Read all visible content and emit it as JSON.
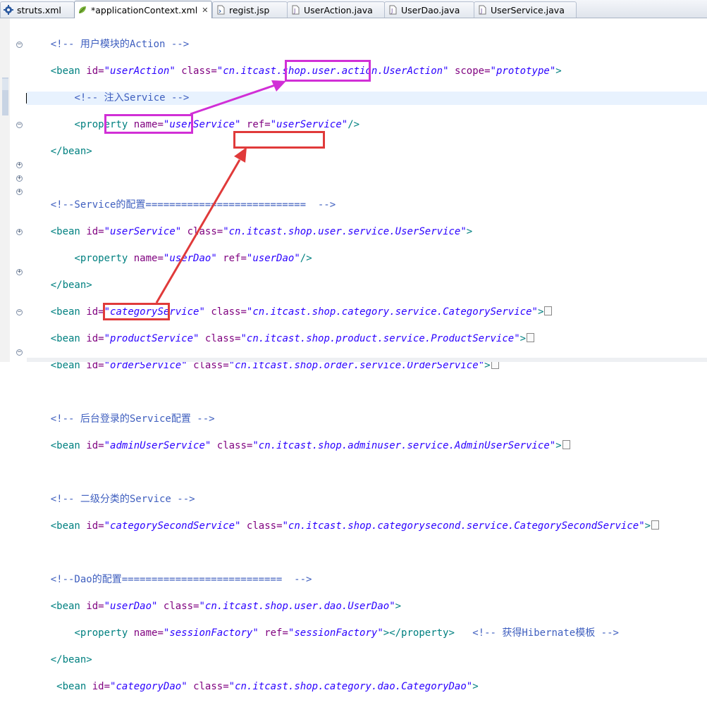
{
  "tabs": [
    {
      "label": "struts.xml",
      "icon": "gear-xml-icon",
      "active": false
    },
    {
      "label": "*applicationContext.xml",
      "icon": "spring-leaf-icon",
      "active": true,
      "close": "✕"
    },
    {
      "label": "regist.jsp",
      "icon": "jsp-file-icon",
      "active": false
    },
    {
      "label": "UserAction.java",
      "icon": "java-file-icon",
      "active": false
    },
    {
      "label": "UserDao.java",
      "icon": "java-file-icon",
      "active": false
    },
    {
      "label": "UserService.java",
      "icon": "java-file-icon",
      "active": false
    }
  ],
  "code": {
    "l01": {
      "comment": "<!-- 用户模块的Action -->"
    },
    "l02": {
      "id": "\"userAction\"",
      "cls": "\"cn.itcast.shop.user.action.UserAction\"",
      "scope": "\"prototype\""
    },
    "l03": {
      "comment": "<!-- 注入Service -->"
    },
    "l04": {
      "name": "\"userService\"",
      "ref": "\"userService\""
    },
    "l07": {
      "comment": "<!--Service的配置===========================  -->"
    },
    "l08": {
      "id": "\"userService\"",
      "cls": "\"cn.itcast.shop.user.service.UserService\""
    },
    "l09": {
      "name": "\"userDao\"",
      "ref": "\"userDao\""
    },
    "l11": {
      "id": "\"categoryService\"",
      "cls": "\"cn.itcast.shop.category.service.CategoryService\""
    },
    "l12": {
      "id": "\"productService\"",
      "cls": "\"cn.itcast.shop.product.service.ProductService\""
    },
    "l13": {
      "id": "\"orderService\"",
      "cls": "\"cn.itcast.shop.order.service.OrderService\""
    },
    "l15": {
      "comment": "<!-- 后台登录的Service配置 -->"
    },
    "l16": {
      "id": "\"adminUserService\"",
      "cls": "\"cn.itcast.shop.adminuser.service.AdminUserService\""
    },
    "l18": {
      "comment": "<!-- 二级分类的Service -->"
    },
    "l19": {
      "id": "\"categorySecondService\"",
      "cls": "\"cn.itcast.shop.categorysecond.service.CategorySecondService\""
    },
    "l21": {
      "comment": "<!--Dao的配置===========================  -->"
    },
    "l22": {
      "id": "\"userDao\"",
      "cls": "\"cn.itcast.shop.user.dao.UserDao\""
    },
    "l23": {
      "name": "\"sessionFactory\"",
      "ref": "\"sessionFactory\"",
      "comment": "<!-- 获得Hibernate模板 -->"
    },
    "l25": {
      "id": "\"categoryDao\"",
      "cls": "\"cn.itcast.shop.category.dao.CategoryDao\""
    }
  },
  "colors": {
    "highlight_magenta": "#d12fd6",
    "highlight_red": "#e03a3a"
  }
}
